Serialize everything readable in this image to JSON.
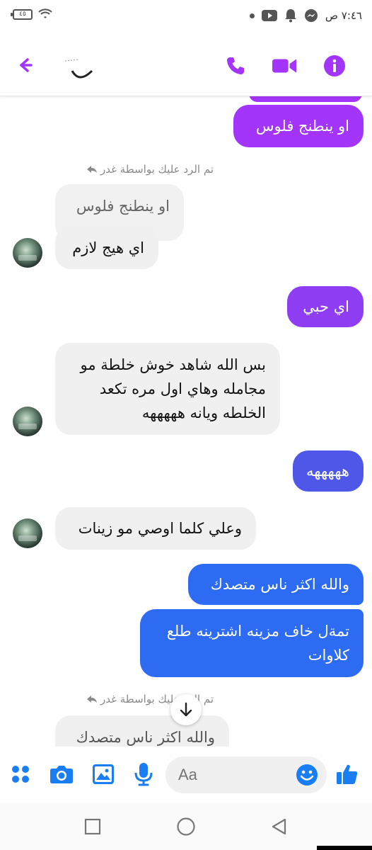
{
  "status_bar": {
    "battery": "٤٥",
    "time": "٧:٤٦ ص",
    "icons": [
      "wifi-icon",
      "battery-icon",
      "dot-icon",
      "youtube-icon",
      "bell-icon",
      "messenger-icon"
    ]
  },
  "header": {
    "icons": [
      "back-arrow-icon",
      "phone-icon",
      "video-icon",
      "info-icon"
    ],
    "accent_color": "#a334fa"
  },
  "messages": [
    {
      "id": "m1",
      "side": "out",
      "text": "او ينطنج فلوس"
    },
    {
      "id": "r1",
      "type": "reply-label",
      "text": "تم الرد عليك بواسطة غدر"
    },
    {
      "id": "m2",
      "side": "in",
      "text": "او ينطنج فلوس",
      "quoted": true
    },
    {
      "id": "m3",
      "side": "in",
      "text": "اي هيج لازم"
    },
    {
      "id": "m4",
      "side": "out",
      "text": "اي حبي"
    },
    {
      "id": "m5",
      "side": "in",
      "lines": [
        "بس الله شاهد خوش خلطة مو",
        "مجامله وهاي اول مره تكعد",
        "الخلطه ويانه هههههه"
      ]
    },
    {
      "id": "m6",
      "side": "out",
      "text": "هههههه"
    },
    {
      "id": "m7",
      "side": "in",
      "text": "وعلي كلما اوصي مو زينات"
    },
    {
      "id": "m8",
      "side": "out",
      "text": "والله اكثر ناس متصدك"
    },
    {
      "id": "m9",
      "side": "out",
      "lines": [
        "تمةل خاف مزينه اشترينه طلع",
        "كلاوات"
      ]
    },
    {
      "id": "r2",
      "type": "reply-label",
      "text": "تم الرد عليك بواسطة غدر"
    },
    {
      "id": "m10",
      "side": "in",
      "text": "والله اكثر ناس متصدك",
      "quoted": true
    }
  ],
  "colors": {
    "outgoing_purple": "#a334fa",
    "outgoing_purple_2": "#8e3df2",
    "outgoing_blue": "#2d6bf3",
    "incoming_gray": "#f0f0f0",
    "accent_blue": "#1a7ef2"
  },
  "composer": {
    "placeholder": "Aa",
    "icons": [
      "menu-dots-icon",
      "camera-icon",
      "image-icon",
      "mic-icon",
      "emoji-icon",
      "like-icon"
    ]
  },
  "nav": {
    "icons": [
      "recents-square-icon",
      "home-circle-icon",
      "back-triangle-icon"
    ]
  }
}
